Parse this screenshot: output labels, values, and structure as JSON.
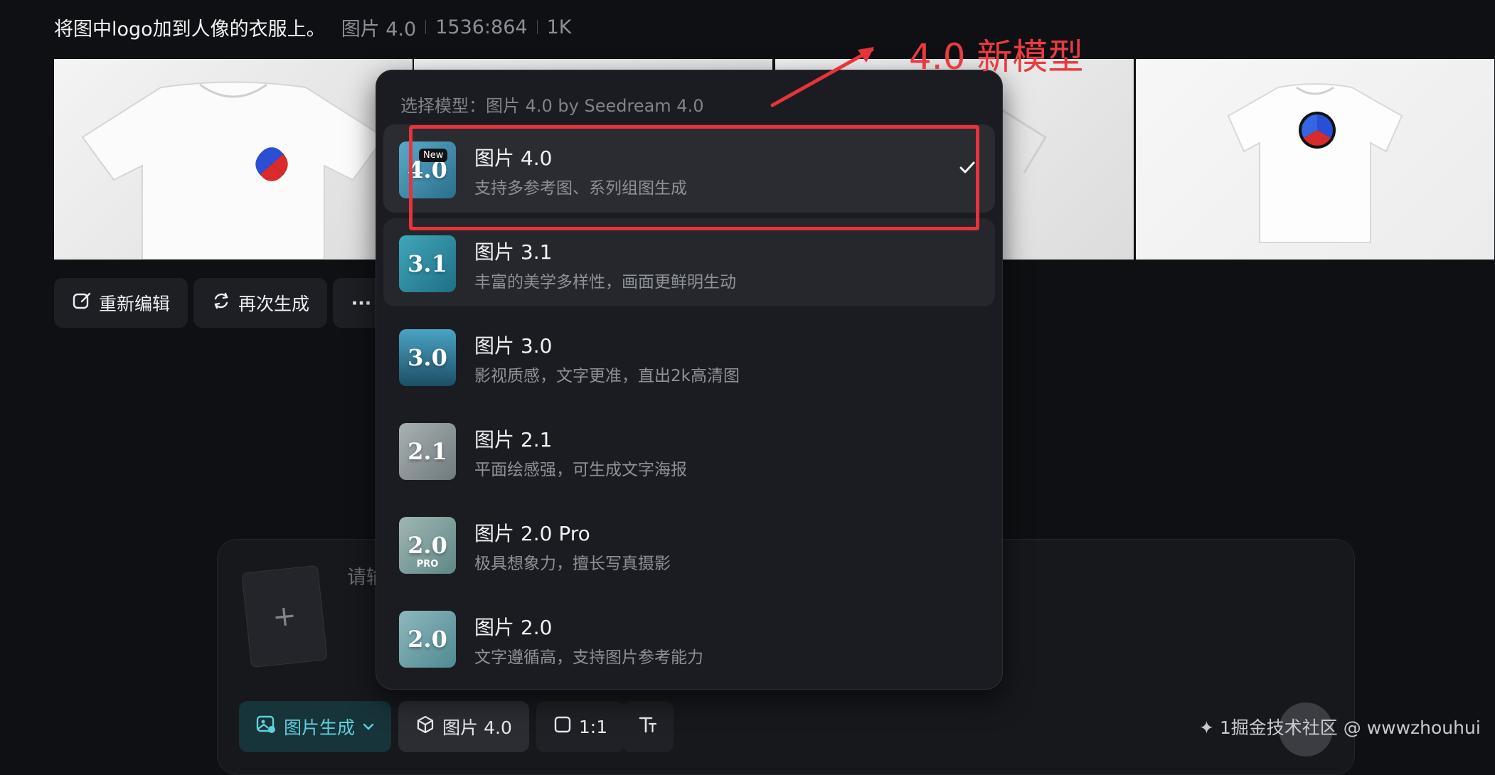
{
  "header": {
    "prompt": "将图中logo加到人像的衣服上。",
    "model": "图片 4.0",
    "resolution": "1536:864",
    "quality": "1K"
  },
  "actions": {
    "reedit": "重新编辑",
    "regenerate": "再次生成",
    "more": "···"
  },
  "dropdown": {
    "title": "选择模型：图片 4.0 by Seedream 4.0",
    "items": [
      {
        "name": "图片 4.0",
        "desc": "支持多参考图、系列组图生成",
        "thumb": "4.0",
        "tag": "New",
        "selected": true
      },
      {
        "name": "图片 3.1",
        "desc": "丰富的美学多样性，画面更鲜明生动",
        "thumb": "3.1"
      },
      {
        "name": "图片 3.0",
        "desc": "影视质感，文字更准，直出2k高清图",
        "thumb": "3.0"
      },
      {
        "name": "图片 2.1",
        "desc": "平面绘感强，可生成文字海报",
        "thumb": "2.1"
      },
      {
        "name": "图片 2.0 Pro",
        "desc": "极具想象力，擅长写真摄影",
        "thumb": "2.0",
        "tag": "PRO"
      },
      {
        "name": "图片 2.0",
        "desc": "文字遵循高，支持图片参考能力",
        "thumb": "2.0"
      }
    ]
  },
  "composer": {
    "placeholder": "请输",
    "upload_symbol": "+"
  },
  "toolbar": {
    "mode": "图片生成",
    "model": "图片 4.0",
    "ratio": "1:1"
  },
  "annotation": {
    "label": "4.0 新模型",
    "color": "#e8333a"
  },
  "watermark": "✦ 1掘金技术社区 @ wwwzhouhui"
}
